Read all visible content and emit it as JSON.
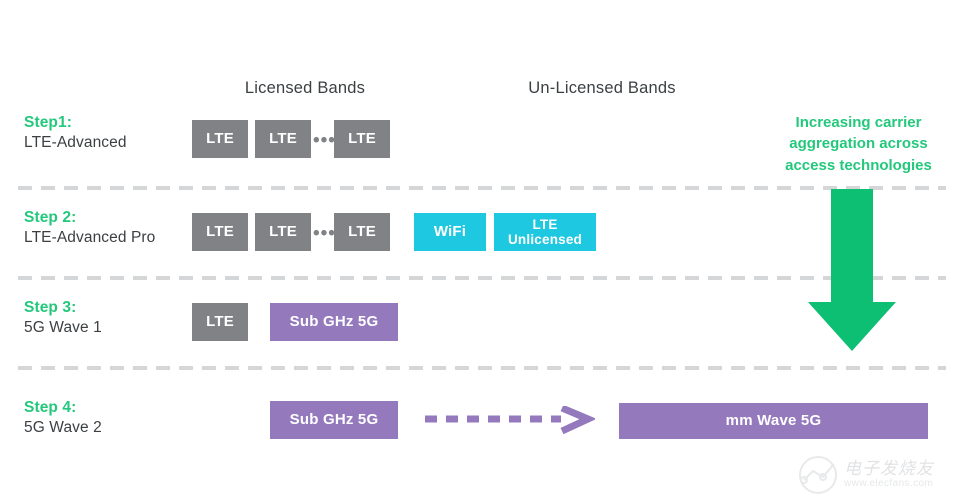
{
  "headers": {
    "licensed": "Licensed Bands",
    "unlicensed": "Un-Licensed Bands"
  },
  "rows": [
    {
      "step_title": "Step1:",
      "step_sub": "LTE-Advanced",
      "boxes": [
        "LTE",
        "LTE",
        "LTE"
      ],
      "ellipsis": "•••"
    },
    {
      "step_title": "Step 2:",
      "step_sub": "LTE-Advanced Pro",
      "boxes": [
        "LTE",
        "LTE",
        "LTE",
        "WiFi",
        "LTE\nUnlicensed"
      ],
      "wifi": "WiFi",
      "lte_unlicensed_line1": "LTE",
      "lte_unlicensed_line2": "Unlicensed",
      "ellipsis": "•••"
    },
    {
      "step_title": "Step 3:",
      "step_sub": "5G Wave 1",
      "boxes": [
        "LTE",
        "Sub GHz 5G"
      ]
    },
    {
      "step_title": "Step 4:",
      "step_sub": "5G Wave 2",
      "boxes": [
        "Sub GHz 5G",
        "mm Wave 5G"
      ]
    }
  ],
  "callout": {
    "line1": "Increasing carrier",
    "line2": "aggregation across",
    "line3": "access technologies"
  },
  "watermark": {
    "cn": "电子发烧友",
    "url": "www.elecfans.com"
  },
  "colors": {
    "green": "#23c87c",
    "gray_box": "#808285",
    "cyan_box": "#1ec8e0",
    "purple_box": "#9479bd",
    "divider": "#d4d6d8",
    "text_dark": "#3c4043"
  }
}
